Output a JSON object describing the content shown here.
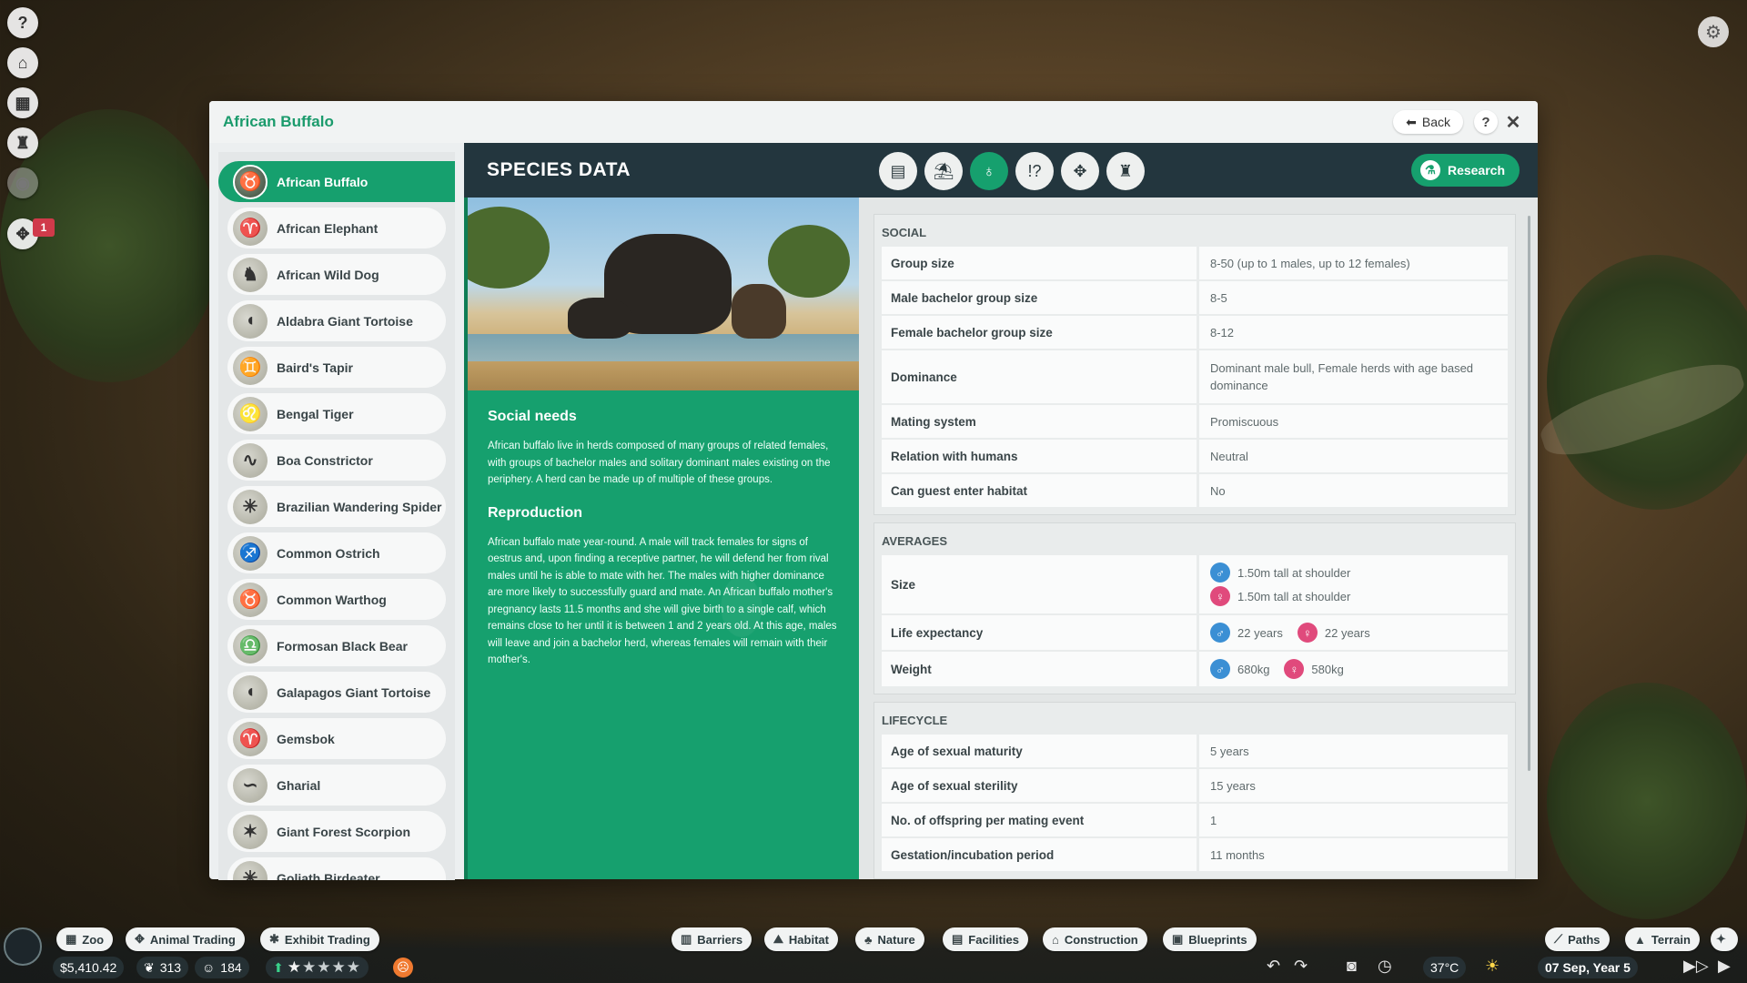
{
  "window": {
    "title": "African Buffalo",
    "back_label": "Back",
    "help_label": "?",
    "close_label": "✕"
  },
  "left_bar": {
    "notification_count": "1"
  },
  "species_list": [
    {
      "name": "African Buffalo",
      "selected": true
    },
    {
      "name": "African Elephant"
    },
    {
      "name": "African Wild Dog"
    },
    {
      "name": "Aldabra Giant Tortoise"
    },
    {
      "name": "Baird's Tapir"
    },
    {
      "name": "Bengal Tiger"
    },
    {
      "name": "Boa Constrictor"
    },
    {
      "name": "Brazilian Wandering Spider"
    },
    {
      "name": "Common Ostrich"
    },
    {
      "name": "Common Warthog"
    },
    {
      "name": "Formosan Black Bear"
    },
    {
      "name": "Galapagos Giant Tortoise"
    },
    {
      "name": "Gemsbok"
    },
    {
      "name": "Gharial"
    },
    {
      "name": "Giant Forest Scorpion"
    },
    {
      "name": "Goliath Birdeater"
    }
  ],
  "panel": {
    "title": "SPECIES DATA",
    "research_label": "Research",
    "tabs": [
      "clipboard-icon",
      "habitat-icon",
      "social-icon",
      "behaviour-icon",
      "paw-icon",
      "trophy-icon"
    ]
  },
  "text": {
    "social_title": "Social needs",
    "social_body": "African buffalo live in herds composed of many groups of related females, with groups of bachelor males and solitary dominant males existing on the periphery. A herd can be made up of multiple of these groups.",
    "repro_title": "Reproduction",
    "repro_body": "African buffalo mate year-round. A male will track females for signs of oestrus and, upon finding a receptive partner, he will defend her from rival males until he is able to mate with her. The males with higher dominance are more likely to successfully guard and mate. An African buffalo mother's pregnancy lasts 11.5 months and she will give birth to a single calf, which remains close to her until it is between 1 and 2 years old. At this age, males will leave and join a bachelor herd, whereas females will remain with their mother's."
  },
  "social": {
    "title": "SOCIAL",
    "rows": [
      {
        "k": "Group size",
        "v": "8-50 (up to 1 males, up to 12 females)"
      },
      {
        "k": "Male bachelor group size",
        "v": "8-5"
      },
      {
        "k": "Female bachelor group size",
        "v": "8-12"
      },
      {
        "k": "Dominance",
        "v": "Dominant male bull, Female herds with age based dominance"
      },
      {
        "k": "Mating system",
        "v": "Promiscuous"
      },
      {
        "k": "Relation with humans",
        "v": "Neutral"
      },
      {
        "k": "Can guest enter habitat",
        "v": "No"
      }
    ]
  },
  "averages": {
    "title": "AVERAGES",
    "size_label": "Size",
    "size_male": "1.50m tall at shoulder",
    "size_female": "1.50m tall at shoulder",
    "life_label": "Life expectancy",
    "life_male": "22 years",
    "life_female": "22 years",
    "weight_label": "Weight",
    "weight_male": "680kg",
    "weight_female": "580kg"
  },
  "lifecycle": {
    "title": "LIFECYCLE",
    "rows": [
      {
        "k": "Age of sexual maturity",
        "v": "5 years"
      },
      {
        "k": "Age of sexual sterility",
        "v": "15 years"
      },
      {
        "k": "No. of offspring per mating event",
        "v": "1"
      },
      {
        "k": "Gestation/incubation period",
        "v": "11 months"
      }
    ]
  },
  "toolbar": {
    "zoo": "Zoo",
    "animal_trading": "Animal Trading",
    "exhibit_trading": "Exhibit Trading",
    "barriers": "Barriers",
    "habitat": "Habitat",
    "nature": "Nature",
    "facilities": "Facilities",
    "construction": "Construction",
    "blueprints": "Blueprints",
    "paths": "Paths",
    "terrain": "Terrain"
  },
  "status": {
    "money": "$5,410.42",
    "conservation": "313",
    "guests": "184",
    "temperature": "37°C",
    "date": "07 Sep, Year 5",
    "star_rating": 1
  }
}
